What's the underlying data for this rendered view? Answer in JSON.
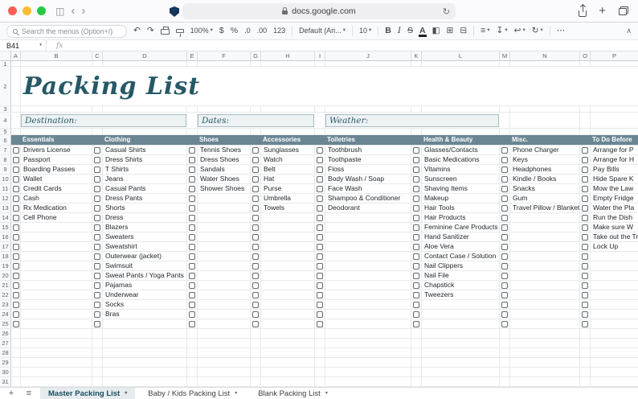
{
  "browser": {
    "url": "docs.google.com",
    "icons": {
      "back": "‹",
      "forward": "›",
      "sidebar": "◫",
      "refresh": "↻",
      "new_tab": "+"
    }
  },
  "toolbar": {
    "search_placeholder": "Search the menus (Option+/)",
    "zoom": "100%",
    "currency": "$",
    "percent": "%",
    "dec_decimal": ".0",
    "inc_decimal": ".00",
    "more_formats": "123",
    "font": "Default (Ari...",
    "font_size": "10",
    "bold": "B",
    "italic": "I",
    "strike": "S",
    "text_color": "A",
    "icons": {
      "undo": "↶",
      "redo": "↷",
      "caret": "▾",
      "fill": "◧",
      "borders": "⊞",
      "merge": "⊟",
      "align": "≡",
      "valign": "↧",
      "wrap": "↩",
      "rotate": "↻",
      "more": "⋯",
      "collapse": "∧"
    }
  },
  "formula_bar": {
    "cell_ref": "B41",
    "fx": "fx"
  },
  "grid": {
    "columns": [
      "A",
      "B",
      "C",
      "D",
      "E",
      "F",
      "G",
      "H",
      "I",
      "J",
      "K",
      "L",
      "M",
      "N",
      "O",
      "P"
    ],
    "row_count": 31,
    "title": {
      "text": "Packing List"
    },
    "fields": [
      {
        "label": "Destination:"
      },
      {
        "label": "Dates:"
      },
      {
        "label": "Weather:"
      }
    ],
    "groups": [
      {
        "header": "Essentials",
        "items": [
          "Drivers License",
          "Passport",
          "Boarding Passes",
          "Wallet",
          "Credit Cards",
          "Cash",
          "Rx Medication",
          "Cell Phone"
        ]
      },
      {
        "header": "Clothing",
        "items": [
          "Casual Shirts",
          "Dress Shirts",
          "T Shirts",
          "Jeans",
          "Casual Pants",
          "Dress Pants",
          "Shorts",
          "Dress",
          "Blazers",
          "Sweaters",
          "Sweatshirt",
          "Outerwear (jacket)",
          "Swimsuit",
          "Sweat Pants / Yoga Pants",
          "Pajamas",
          "Underwear",
          "Socks",
          "Bras"
        ]
      },
      {
        "header": "Shoes",
        "items": [
          "Tennis Shoes",
          "Dress Shoes",
          "Sandals",
          "Water Shoes",
          "Shower Shoes"
        ]
      },
      {
        "header": "Accessories",
        "items": [
          "Sunglasses",
          "Watch",
          "Belt",
          "Hat",
          "Purse",
          "Umbrella",
          "Towels"
        ]
      },
      {
        "header": "Toiletries",
        "items": [
          "Toothbrush",
          "Toothpaste",
          "Floss",
          "Body Wash / Soap",
          "Face Wash",
          "Shampoo & Conditioner",
          "Deodorant"
        ]
      },
      {
        "header": "Health & Beauty",
        "items": [
          "Glasses/Contacts",
          "Basic Medications",
          "Vitamins",
          "Sunscreen",
          "Shaving Items",
          "Makeup",
          "Hair Tools",
          "Hair Products",
          "Feminine Care Products",
          "Hand Sanitizer",
          "Aloe Vera",
          "Contact Case / Solution",
          "Nail Clippers",
          "Nail File",
          "Chapstick",
          "Tweezers"
        ]
      },
      {
        "header": "Misc.",
        "items": [
          "Phone Charger",
          "Keys",
          "Headphones",
          "Kindle / Books",
          "Snacks",
          "Gum",
          "Travel Pillow / Blanket"
        ]
      },
      {
        "header": "To Do Before",
        "items": [
          "Arrange for P",
          "Arrange for H",
          "Pay Bills",
          "Hide Spare K",
          "Mow the Law",
          "Empty Fridge",
          "Water the Pla",
          "Run the Dish",
          "Make sure W",
          "Take out the Tr",
          "Lock Up"
        ]
      }
    ],
    "colors": {
      "band": "#6a8693",
      "title": "#265866",
      "field_bg": "#edf2f4",
      "field_border": "#a7b9c1",
      "tab_active_bg": "#e6ebee",
      "tab_active_text": "#174f5f"
    }
  },
  "tabs": {
    "add": "+",
    "all": "≡",
    "caret": "▾",
    "items": [
      {
        "label": "Master Packing List",
        "active": true
      },
      {
        "label": "Baby / Kids Packing List",
        "active": false
      },
      {
        "label": "Blank Packing List",
        "active": false
      }
    ]
  }
}
